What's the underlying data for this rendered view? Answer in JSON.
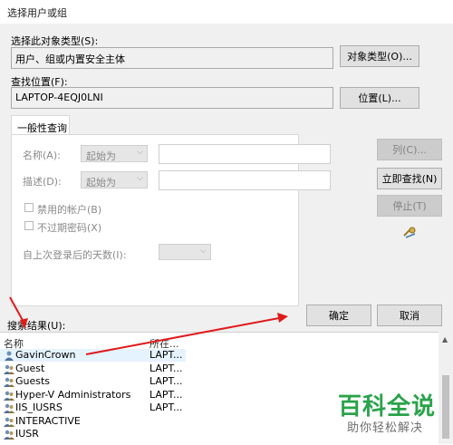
{
  "window": {
    "title": "选择用户或组"
  },
  "object_type": {
    "label": "选择此对象类型(S):",
    "value": "用户、组或内置安全主体",
    "button": "对象类型(O)..."
  },
  "location": {
    "label": "查找位置(F):",
    "value": "LAPTOP-4EQJ0LNI",
    "button": "位置(L)..."
  },
  "tab": {
    "label": "一般性查询"
  },
  "query": {
    "name_label": "名称(A):",
    "name_mode": "起始为",
    "desc_label": "描述(D):",
    "desc_mode": "起始为",
    "disabled_accounts": "禁用的帐户(B)",
    "no_expire": "不过期密码(X)",
    "days_label": "自上次登录后的天数(I):"
  },
  "buttons": {
    "columns": "列(C)...",
    "find_now": "立即查找(N)",
    "stop": "停止(T)",
    "ok": "确定",
    "cancel": "取消"
  },
  "results": {
    "label": "搜索结果(U):",
    "headers": {
      "name": "名称",
      "location": "所在..."
    },
    "rows": [
      {
        "name": "GavinCrown",
        "location": "LAPT...",
        "icon": "user-icon",
        "selected": true
      },
      {
        "name": "Guest",
        "location": "LAPT...",
        "icon": "group-icon"
      },
      {
        "name": "Guests",
        "location": "LAPT...",
        "icon": "group-icon"
      },
      {
        "name": "Hyper-V Administrators",
        "location": "LAPT...",
        "icon": "group-icon"
      },
      {
        "name": "IIS_IUSRS",
        "location": "LAPT...",
        "icon": "group-icon"
      },
      {
        "name": "INTERACTIVE",
        "location": "",
        "icon": "group-icon"
      },
      {
        "name": "IUSR",
        "location": "",
        "icon": "group-icon"
      }
    ]
  },
  "watermark": {
    "line1": "百科全说",
    "line2": "助你轻松解决"
  },
  "colors": {
    "annotation": "#e01b1b",
    "watermark": "#2aa34a",
    "selection": "#e5f3ff"
  }
}
